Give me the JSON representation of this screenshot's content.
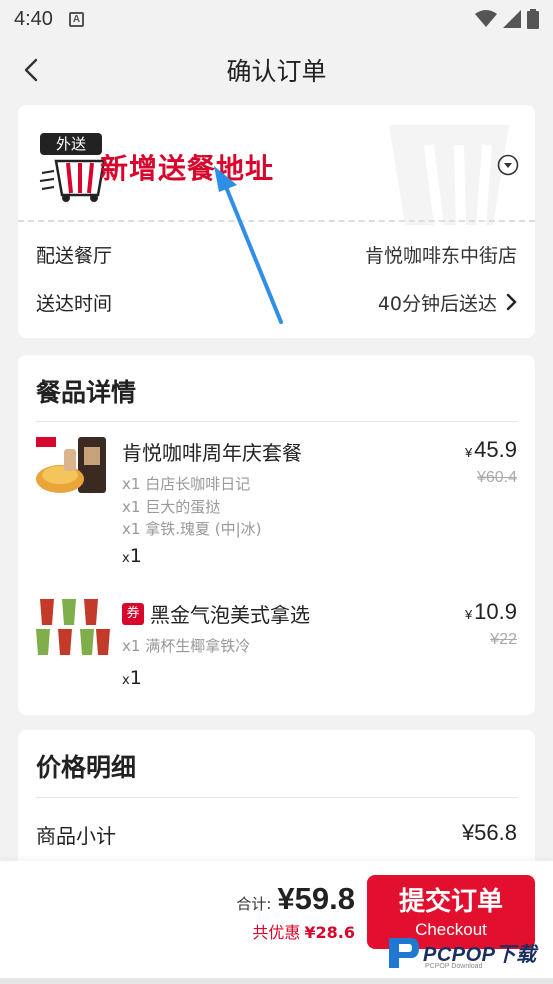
{
  "status_bar": {
    "time": "4:40",
    "a_icon": "A"
  },
  "nav": {
    "title": "确认订单",
    "back_icon": "chevron-left-icon"
  },
  "address": {
    "badge": "外送",
    "add_label": "新增送餐地址",
    "restaurant_label": "配送餐厅",
    "restaurant_value": "肯悦咖啡东中街店",
    "time_label": "送达时间",
    "time_value": "40分钟后送达"
  },
  "items": {
    "title": "餐品详情",
    "list": [
      {
        "name": "肯悦咖啡周年庆套餐",
        "subs": [
          "x1 白店长咖啡日记",
          "x1 巨大的蛋挞",
          "x1 拿铁.瑰夏 (中|冰)"
        ],
        "qty_x": "x",
        "qty": "1",
        "price_symbol": "¥",
        "price": "45.9",
        "old_price": "¥60.4"
      },
      {
        "tag": "券",
        "name": "黑金气泡美式拿选",
        "subs": [
          "x1 满杯生椰拿铁冷"
        ],
        "qty_x": "x",
        "qty": "1",
        "price_symbol": "¥",
        "price": "10.9",
        "old_price": "¥22"
      }
    ]
  },
  "price": {
    "title": "价格明细",
    "subtotal_label": "商品小计",
    "subtotal_value": "¥56.8"
  },
  "bottom": {
    "total_label": "合计:",
    "total_value": "¥59.8",
    "discount_label": "共优惠",
    "discount_value": "¥28.6",
    "submit_cn": "提交订单",
    "submit_en": "Checkout"
  },
  "watermark": {
    "text": "PCPOP下载",
    "sub": "PCPOP Download"
  },
  "colors": {
    "brand_red": "#e2102e",
    "accent_red": "#d8062c",
    "annotation_blue": "#2f8fe8"
  }
}
